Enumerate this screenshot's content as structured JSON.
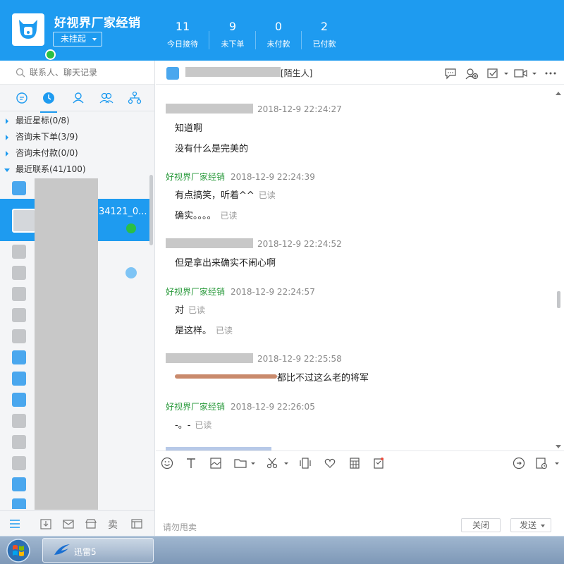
{
  "header": {
    "shop_name": "好视界厂家经销",
    "status": "未挂起",
    "stats": [
      {
        "num": "11",
        "label": "今日接待"
      },
      {
        "num": "9",
        "label": "未下单"
      },
      {
        "num": "0",
        "label": "未付款"
      },
      {
        "num": "2",
        "label": "已付款"
      }
    ]
  },
  "sidebar": {
    "search_placeholder": "联系人、聊天记录",
    "groups": [
      {
        "label": "最近星标(0/8)",
        "open": false
      },
      {
        "label": "咨询未下单(3/9)",
        "open": false
      },
      {
        "label": "咨询未付款(0/0)",
        "open": false
      },
      {
        "label": "最近联系(41/100)",
        "open": true
      }
    ],
    "selected_contact": "34121_0...",
    "contact_count_visible": 16
  },
  "chat": {
    "title_suffix": "[陌生人]",
    "messages": [
      {
        "sender": "",
        "time": "2018-12-9 22:24:27",
        "lines": [
          {
            "text": "知道啊",
            "status": ""
          },
          {
            "text": "没有什么是完美的",
            "status": ""
          }
        ]
      },
      {
        "sender": "好视界厂家经销",
        "time": "2018-12-9 22:24:39",
        "lines": [
          {
            "text": "有点搞笑，听着^^",
            "status": "已读"
          },
          {
            "text": "确实。。。。",
            "status": "已读"
          }
        ]
      },
      {
        "sender": "",
        "time": "2018-12-9 22:24:52",
        "lines": [
          {
            "text": "但是拿出来确实不闹心啊",
            "status": ""
          }
        ]
      },
      {
        "sender": "好视界厂家经销",
        "time": "2018-12-9 22:24:57",
        "lines": [
          {
            "text": "对",
            "status": "已读"
          },
          {
            "text": "是这样。",
            "status": "已读"
          }
        ]
      },
      {
        "sender": "",
        "time": "2018-12-9 22:25:58",
        "lines": [
          {
            "text": "都比不过这么老的将军",
            "status": ""
          }
        ]
      },
      {
        "sender": "好视界厂家经销",
        "time": "2018-12-9 22:26:05",
        "lines": [
          {
            "text": "-。-",
            "status": "已读"
          }
        ]
      }
    ]
  },
  "composer": {
    "hint": "请勿甩卖",
    "close_label": "关闭",
    "send_label": "发送"
  },
  "taskbar": {
    "task_label": "迅雷5"
  }
}
